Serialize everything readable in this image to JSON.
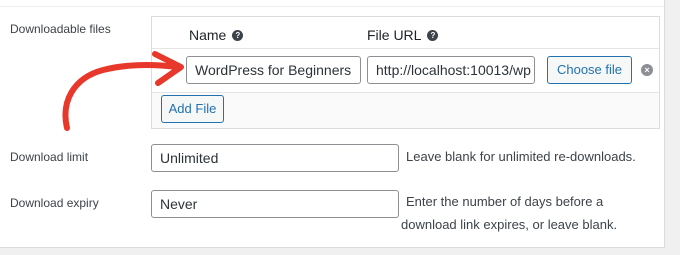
{
  "downloadable_files": {
    "label": "Downloadable files",
    "col_name": "Name",
    "col_url": "File URL",
    "rows": [
      {
        "name": "WordPress for Beginners",
        "url": "http://localhost:10013/wp",
        "choose_label": "Choose file"
      }
    ],
    "add_file_label": "Add File"
  },
  "download_limit": {
    "label": "Download limit",
    "value": "Unlimited",
    "description": "Leave blank for unlimited re-downloads."
  },
  "download_expiry": {
    "label": "Download expiry",
    "value": "Never",
    "description_line1": "Enter the number of days before a",
    "description_line2": "download link expires, or leave blank."
  },
  "colors": {
    "accent": "#2271b1",
    "annotation_arrow": "#e8382b"
  },
  "icons": [
    "help-icon",
    "remove-icon",
    "annotation-arrow"
  ]
}
